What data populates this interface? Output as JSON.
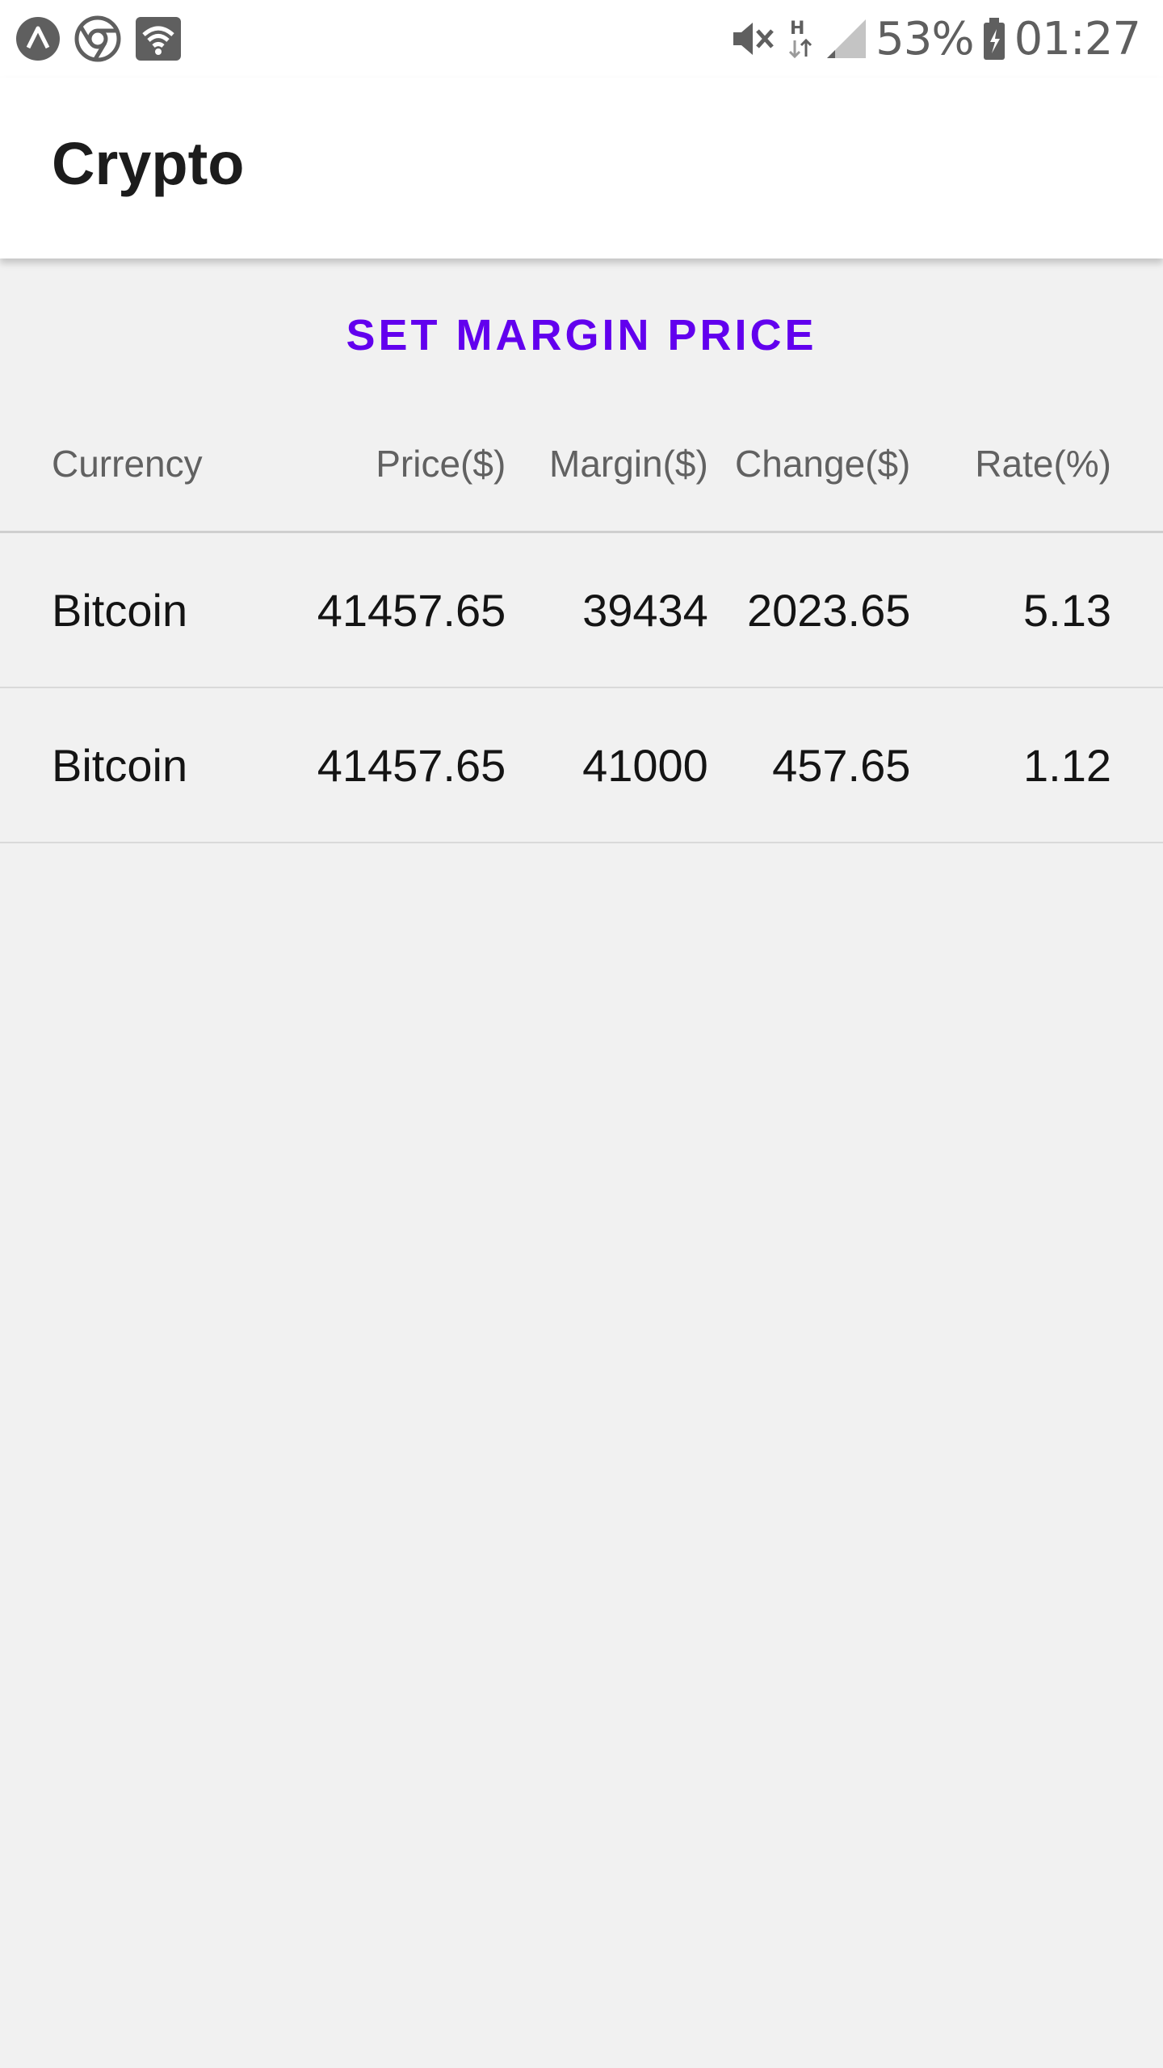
{
  "status_bar": {
    "left_icons": [
      "app-notification-icon",
      "chrome-icon",
      "wifi-icon"
    ],
    "right_icons": [
      "mute-icon",
      "network-h-icon",
      "signal-icon",
      "battery-icon"
    ],
    "battery_percent": "53%",
    "time": "01:27"
  },
  "app_bar": {
    "title": "Crypto"
  },
  "actions": {
    "set_margin_label": "SET MARGIN PRICE"
  },
  "colors": {
    "accent": "#6200ee",
    "background": "#f1f1f1",
    "surface": "#ffffff"
  },
  "table": {
    "headers": {
      "currency": "Currency",
      "price": "Price($)",
      "margin": "Margin($)",
      "change": "Change($)",
      "rate": "Rate(%)"
    },
    "rows": [
      {
        "currency": "Bitcoin",
        "price": "41457.65",
        "margin": "39434",
        "change": "2023.65",
        "rate": "5.13"
      },
      {
        "currency": "Bitcoin",
        "price": "41457.65",
        "margin": "41000",
        "change": "457.65",
        "rate": "1.12"
      }
    ]
  }
}
